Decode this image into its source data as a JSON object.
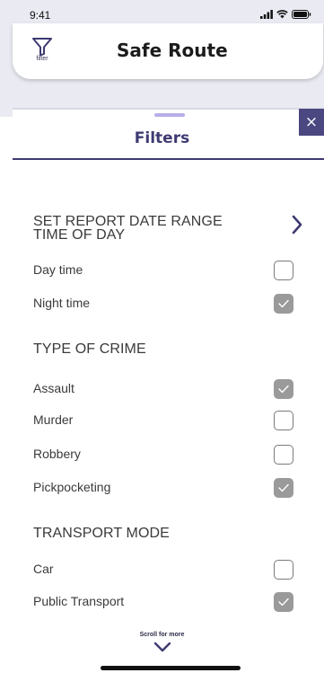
{
  "status_bar": {
    "time": "9:41"
  },
  "header": {
    "title": "Safe Route",
    "filter_label": "filter"
  },
  "sheet": {
    "title": "Filters",
    "close_label": "×",
    "date_range_label": "SET REPORT DATE RANGE",
    "time_of_day": {
      "heading": "TIME OF DAY",
      "options": [
        {
          "label": "Day time",
          "checked": false
        },
        {
          "label": "Night time",
          "checked": true
        }
      ]
    },
    "type_of_crime": {
      "heading": "TYPE OF CRIME",
      "options": [
        {
          "label": "Assault",
          "checked": true
        },
        {
          "label": "Murder",
          "checked": false
        },
        {
          "label": "Robbery",
          "checked": false
        },
        {
          "label": "Pickpocketing",
          "checked": true
        }
      ]
    },
    "transport_mode": {
      "heading": "TRANSPORT MODE",
      "options": [
        {
          "label": "Car",
          "checked": false
        },
        {
          "label": "Public Transport",
          "checked": true
        }
      ]
    },
    "scroll_hint": "Scroll for more"
  },
  "colors": {
    "accent": "#3d3a72",
    "close_bg": "#4a4781",
    "handle": "#b8aee8",
    "checked": "#9a9a9a"
  },
  "icons": {
    "filter": "funnel-icon",
    "chevron_right": "chevron-right-icon",
    "chevron_down": "chevron-down-icon"
  }
}
